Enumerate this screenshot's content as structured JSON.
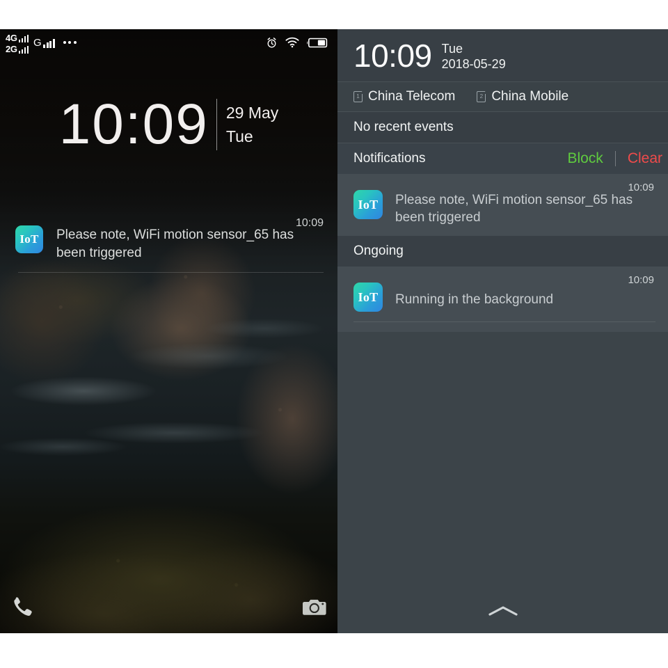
{
  "lockscreen": {
    "status_bar": {
      "sim1_network": "4G",
      "sim2_network": "2G",
      "sim3_network": "G",
      "more_icon": "more-dots-icon",
      "alarm_icon": "alarm-clock-icon",
      "wifi_icon": "wifi-icon",
      "battery_icon": "battery-icon"
    },
    "clock": {
      "time": "10:09",
      "date": "29 May",
      "weekday": "Tue"
    },
    "notification": {
      "time": "10:09",
      "app_icon_label": "IoT",
      "text": "Please note, WiFi motion sensor_65 has been triggered"
    },
    "shortcuts": {
      "phone_icon": "phone-icon",
      "camera_icon": "camera-icon"
    }
  },
  "shade": {
    "header": {
      "time": "10:09",
      "weekday": "Tue",
      "date": "2018-05-29"
    },
    "sims": [
      {
        "slot": "1",
        "name": "China Telecom"
      },
      {
        "slot": "2",
        "name": "China Mobile"
      }
    ],
    "events_row": "No recent events",
    "notifications_header": {
      "label": "Notifications",
      "block_label": "Block",
      "clear_label": "Clear",
      "block_color": "#5fcb3f",
      "clear_color": "#ef4b4b"
    },
    "notification_cards": [
      {
        "time": "10:09",
        "app_icon_label": "IoT",
        "text": "Please note, WiFi motion sensor_65 has been triggered"
      }
    ],
    "ongoing_header": "Ongoing",
    "ongoing_cards": [
      {
        "time": "10:09",
        "app_icon_label": "IoT",
        "text": "Running in the background"
      }
    ],
    "collapse_icon": "chevron-up-icon"
  }
}
